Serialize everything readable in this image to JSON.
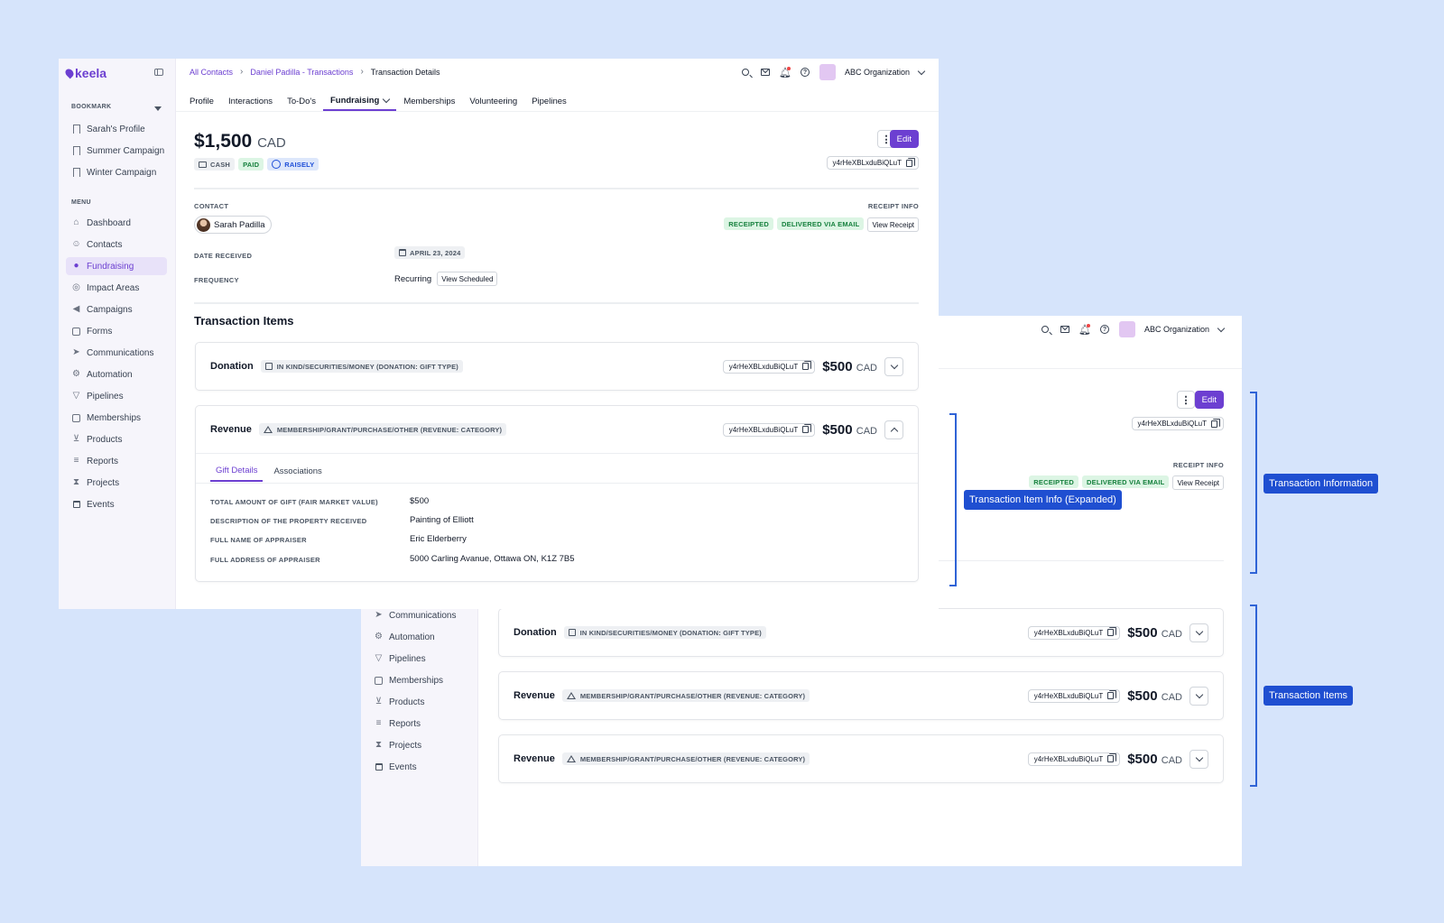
{
  "colors": {
    "accent": "#6c3fd1",
    "background": "#d6e4fb",
    "annotation": "#1f4fd1"
  },
  "sidebar": {
    "logo": "keela",
    "bookmark_heading": "BOOKMARK",
    "bookmarks": [
      "Sarah's Profile",
      "Summer Campaign",
      "Winter Campaign"
    ],
    "menu_heading": "MENU",
    "items": [
      "Dashboard",
      "Contacts",
      "Fundraising",
      "Impact Areas",
      "Campaigns",
      "Forms",
      "Communications",
      "Automation",
      "Pipelines",
      "Memberships",
      "Products",
      "Reports",
      "Projects",
      "Events"
    ],
    "active_item": "Fundraising"
  },
  "header": {
    "breadcrumbs": [
      "All Contacts",
      "Daniel Padilla - Transactions",
      "Transaction Details"
    ],
    "org_name": "ABC Organization"
  },
  "tabs": [
    "Profile",
    "Interactions",
    "To-Do's",
    "Fundraising",
    "Memberships",
    "Volunteering",
    "Pipelines"
  ],
  "transaction": {
    "amount": "$1,500",
    "currency": "CAD",
    "badges": [
      "CASH",
      "PAID",
      "RAISELY"
    ],
    "edit_label": "Edit",
    "more_label": "⋮",
    "id": "y4rHeXBLxduBiQLuT",
    "contact_label": "CONTACT",
    "contact_name": "Sarah Padilla",
    "receipt_label": "RECEIPT INFO",
    "receipt_badges": [
      "RECEIPTED",
      "DELIVERED VIA EMAIL"
    ],
    "view_receipt": "View Receipt",
    "date_label": "DATE RECEIVED",
    "date_value": "APRIL 23, 2024",
    "frequency_label": "FREQUENCY",
    "frequency_value": "Recurring",
    "view_scheduled": "View Scheduled"
  },
  "items_title": "Transaction Items",
  "items": [
    {
      "name": "Donation",
      "type": "IN KIND/SECURITIES/MONEY (DONATION: GIFT TYPE)",
      "id": "y4rHeXBLxduBiQLuT",
      "amount": "$500",
      "currency": "CAD"
    },
    {
      "name": "Revenue",
      "type": "MEMBERSHIP/GRANT/PURCHASE/OTHER (REVENUE: CATEGORY)",
      "id": "y4rHeXBLxduBiQLuT",
      "amount": "$500",
      "currency": "CAD"
    },
    {
      "name": "Revenue",
      "type": "MEMBERSHIP/GRANT/PURCHASE/OTHER (REVENUE: CATEGORY)",
      "id": "y4rHeXBLxduBiQLuT",
      "amount": "$500",
      "currency": "CAD"
    }
  ],
  "expanded_item": {
    "subtabs": [
      "Gift Details",
      "Associations"
    ],
    "details": [
      {
        "label": "TOTAL AMOUNT OF GIFT (FAIR MARKET VALUE)",
        "value": "$500"
      },
      {
        "label": "DESCRIPTION OF THE PROPERTY RECEIVED",
        "value": "Painting of Elliott"
      },
      {
        "label": "FULL NAME OF APPRAISER",
        "value": "Eric Elderberry"
      },
      {
        "label": "FULL ADDRESS OF APPRAISER",
        "value": "5000 Carling Avanue, Ottawa ON, K1Z 7B5"
      }
    ]
  },
  "annotations": {
    "item_info": "Transaction Item Info (Expanded)",
    "transaction_info": "Transaction Information",
    "transaction_items": "Transaction Items"
  }
}
